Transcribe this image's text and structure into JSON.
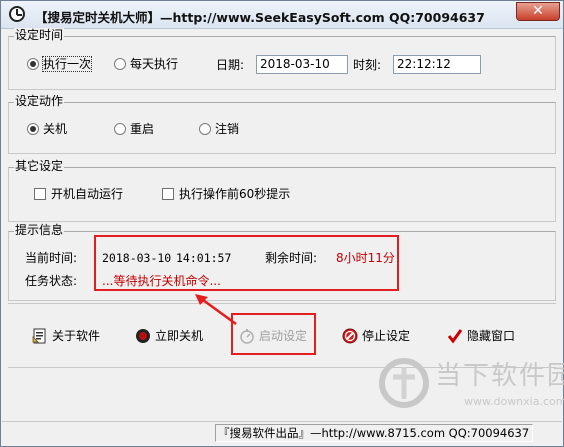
{
  "window": {
    "title": "【搜易定时关机大师】—http://www.SeekEasySoft.com QQ:70094637",
    "close_label": "✕"
  },
  "schedule": {
    "group_title": "设定时间",
    "once_label": "执行一次",
    "daily_label": "每天执行",
    "selected": "once",
    "date_label": "日期:",
    "date_value": "2018-03-10",
    "time_label": "时刻:",
    "time_value": "22:12:12"
  },
  "action": {
    "group_title": "设定动作",
    "options": [
      "关机",
      "重启",
      "注销"
    ],
    "selected": "关机"
  },
  "other": {
    "group_title": "其它设定",
    "autorun_label": "开机自动运行",
    "autorun_checked": false,
    "notify_label": "执行操作前60秒提示",
    "notify_checked": false
  },
  "info": {
    "group_title": "提示信息",
    "current_time_label": "当前时间:",
    "current_date": "2018-03-10",
    "current_time": "14:01:57",
    "remaining_label": "剩余时间:",
    "remaining_value": "8小时11分",
    "status_label": "任务状态:",
    "status_value": "...等待执行关机命令..."
  },
  "buttons": {
    "about": "关于软件",
    "shutdown_now": "立即关机",
    "start": "启动设定",
    "stop": "停止设定",
    "hide": "隐藏窗口"
  },
  "statusbar": {
    "text": "『搜易软件出品』—http://www.8715.com QQ:70094637"
  },
  "watermark": {
    "brand": "当下软件园",
    "url": "www.downxia.com"
  },
  "colors": {
    "highlight": "#e41e1e",
    "info_text": "#c00000",
    "check_mark": "#cc0000"
  }
}
